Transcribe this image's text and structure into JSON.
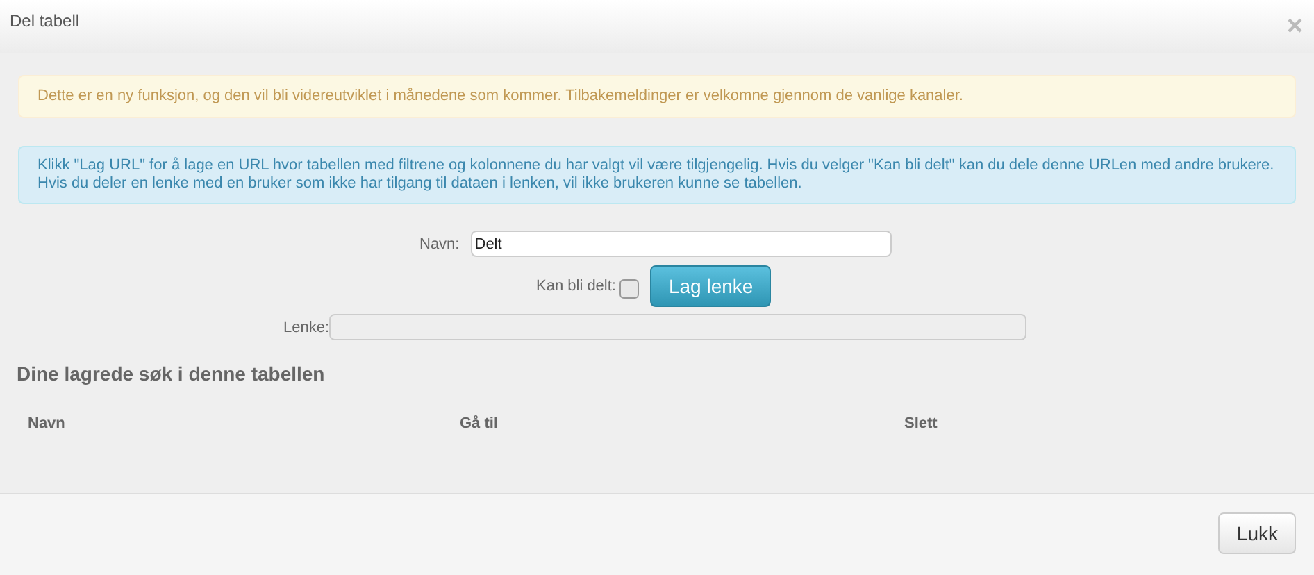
{
  "window": {
    "title": "Del tabell",
    "close": "×"
  },
  "alerts": [
    {
      "kind": "warning",
      "text": "Dette er en ny funksjon, og den vil bli videreutviklet i månedene som kommer. Tilbakemeldinger er velkomne gjennom de vanlige kanaler."
    },
    {
      "kind": "info",
      "text": "Klikk \"Lag URL\" for å lage en URL hvor tabellen med filtrene og kolonnene du har valgt vil være tilgjengelig. Hvis du velger \"Kan bli delt\" kan du dele denne URLen med andre brukere. Hvis du deler en lenke med en bruker som ikke har tilgang til dataen i lenken, vil ikke brukeren kunne se tabellen."
    }
  ],
  "form": {
    "name_label": "Navn:",
    "name_value": "Delt",
    "share_label": "Kan bli delt:",
    "share_checked": false,
    "make_link_button": "Lag lenke",
    "link_label": "Lenke:"
  },
  "saved": {
    "heading": "Dine lagrede søk i denne tabellen",
    "columns": [
      "Navn",
      "Gå til",
      "Slett"
    ]
  },
  "footer": {
    "close_button": "Lukk"
  }
}
